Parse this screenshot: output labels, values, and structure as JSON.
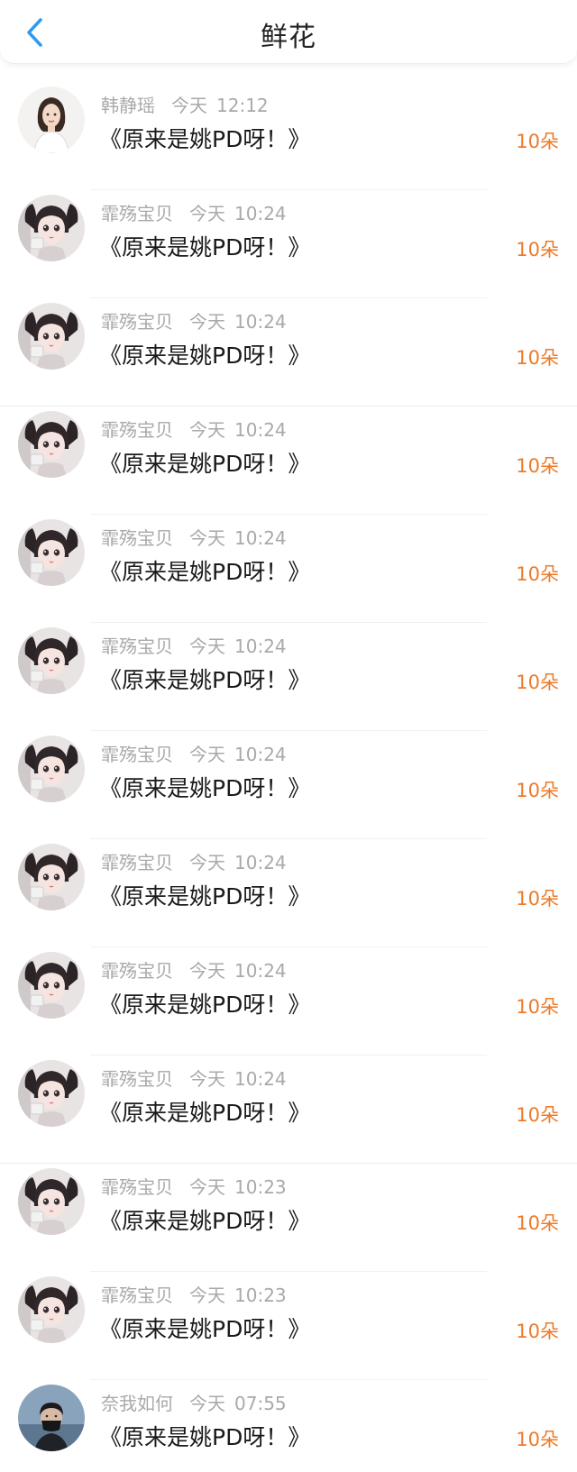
{
  "header": {
    "title": "鲜花",
    "back_icon": "chevron-left-icon",
    "accent_color": "#2e9af0"
  },
  "items": [
    {
      "name": "韩静瑶",
      "day": "今天",
      "time": "12:12",
      "title": "《原来是姚PD呀！》",
      "amount": "10朵",
      "avatar": "girl-white-dress"
    },
    {
      "name": "霏殇宝贝",
      "day": "今天",
      "time": "10:24",
      "title": "《原来是姚PD呀！》",
      "amount": "10朵",
      "avatar": "doll-girl"
    },
    {
      "name": "霏殇宝贝",
      "day": "今天",
      "time": "10:24",
      "title": "《原来是姚PD呀！》",
      "amount": "10朵",
      "avatar": "doll-girl"
    },
    {
      "name": "霏殇宝贝",
      "day": "今天",
      "time": "10:24",
      "title": "《原来是姚PD呀！》",
      "amount": "10朵",
      "avatar": "doll-girl"
    },
    {
      "name": "霏殇宝贝",
      "day": "今天",
      "time": "10:24",
      "title": "《原来是姚PD呀！》",
      "amount": "10朵",
      "avatar": "doll-girl"
    },
    {
      "name": "霏殇宝贝",
      "day": "今天",
      "time": "10:24",
      "title": "《原来是姚PD呀！》",
      "amount": "10朵",
      "avatar": "doll-girl"
    },
    {
      "name": "霏殇宝贝",
      "day": "今天",
      "time": "10:24",
      "title": "《原来是姚PD呀！》",
      "amount": "10朵",
      "avatar": "doll-girl"
    },
    {
      "name": "霏殇宝贝",
      "day": "今天",
      "time": "10:24",
      "title": "《原来是姚PD呀！》",
      "amount": "10朵",
      "avatar": "doll-girl"
    },
    {
      "name": "霏殇宝贝",
      "day": "今天",
      "time": "10:24",
      "title": "《原来是姚PD呀！》",
      "amount": "10朵",
      "avatar": "doll-girl"
    },
    {
      "name": "霏殇宝贝",
      "day": "今天",
      "time": "10:24",
      "title": "《原来是姚PD呀！》",
      "amount": "10朵",
      "avatar": "doll-girl"
    },
    {
      "name": "霏殇宝贝",
      "day": "今天",
      "time": "10:23",
      "title": "《原来是姚PD呀！》",
      "amount": "10朵",
      "avatar": "doll-girl"
    },
    {
      "name": "霏殇宝贝",
      "day": "今天",
      "time": "10:23",
      "title": "《原来是姚PD呀！》",
      "amount": "10朵",
      "avatar": "doll-girl"
    },
    {
      "name": "奈我如何",
      "day": "今天",
      "time": "07:55",
      "title": "《原来是姚PD呀！》",
      "amount": "10朵",
      "avatar": "masked-boy"
    }
  ]
}
